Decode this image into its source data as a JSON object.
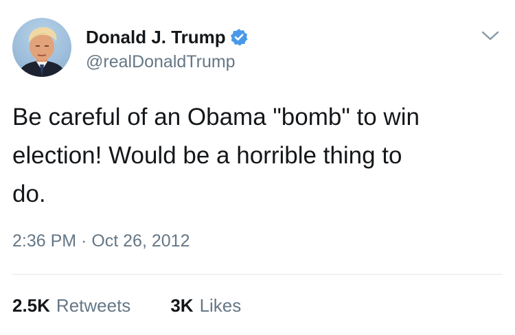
{
  "author": {
    "display_name": "Donald J. Trump",
    "handle": "@realDonaldTrump",
    "verified": true,
    "verified_color": "#4a99e9"
  },
  "tweet": {
    "text": "Be careful of an Obama \"bomb\" to win\nelection! Would be a horrible thing to\ndo.",
    "timestamp": "2:36 PM · Oct 26, 2012"
  },
  "stats": {
    "retweets_count": "2.5K",
    "retweets_label": "Retweets",
    "likes_count": "3K",
    "likes_label": "Likes"
  },
  "icons": {
    "menu": "chevron-down-icon",
    "verified": "verified-badge-icon",
    "avatar": "avatar"
  },
  "colors": {
    "text_primary": "#14171a",
    "text_secondary": "#657786",
    "divider": "#e1e8ed",
    "background": "#ffffff"
  }
}
